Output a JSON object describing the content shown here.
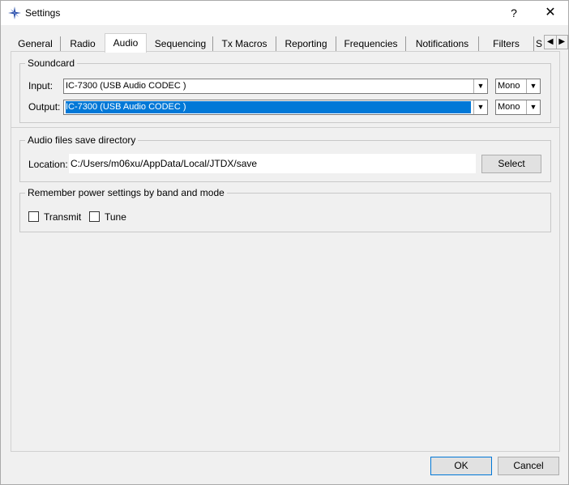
{
  "window": {
    "title": "Settings",
    "help_glyph": "?",
    "close_glyph": "✕"
  },
  "tabs": [
    {
      "label": "General"
    },
    {
      "label": "Radio"
    },
    {
      "label": "Audio"
    },
    {
      "label": "Sequencing"
    },
    {
      "label": "Tx Macros"
    },
    {
      "label": "Reporting"
    },
    {
      "label": "Frequencies"
    },
    {
      "label": "Notifications"
    },
    {
      "label": "Filters"
    },
    {
      "label": "S"
    }
  ],
  "tab_scroll": {
    "left": "◀",
    "right": "▶"
  },
  "soundcard": {
    "title": "Soundcard",
    "input_label": "Input:",
    "input_value": "IC-7300 (USB Audio CODEC )",
    "input_channel": "Mono",
    "output_label": "Output:",
    "output_value": "IC-7300 (USB Audio CODEC )",
    "output_channel": "Mono"
  },
  "save_dir": {
    "title": "Audio files save directory",
    "location_label": "Location:",
    "location_value": "C:/Users/m06xu/AppData/Local/JTDX/save",
    "select_label": "Select"
  },
  "power": {
    "title": "Remember power settings by band and mode",
    "transmit_label": "Transmit",
    "tune_label": "Tune"
  },
  "footer": {
    "ok_label": "OK",
    "cancel_label": "Cancel"
  },
  "arrow_glyph": "▼"
}
